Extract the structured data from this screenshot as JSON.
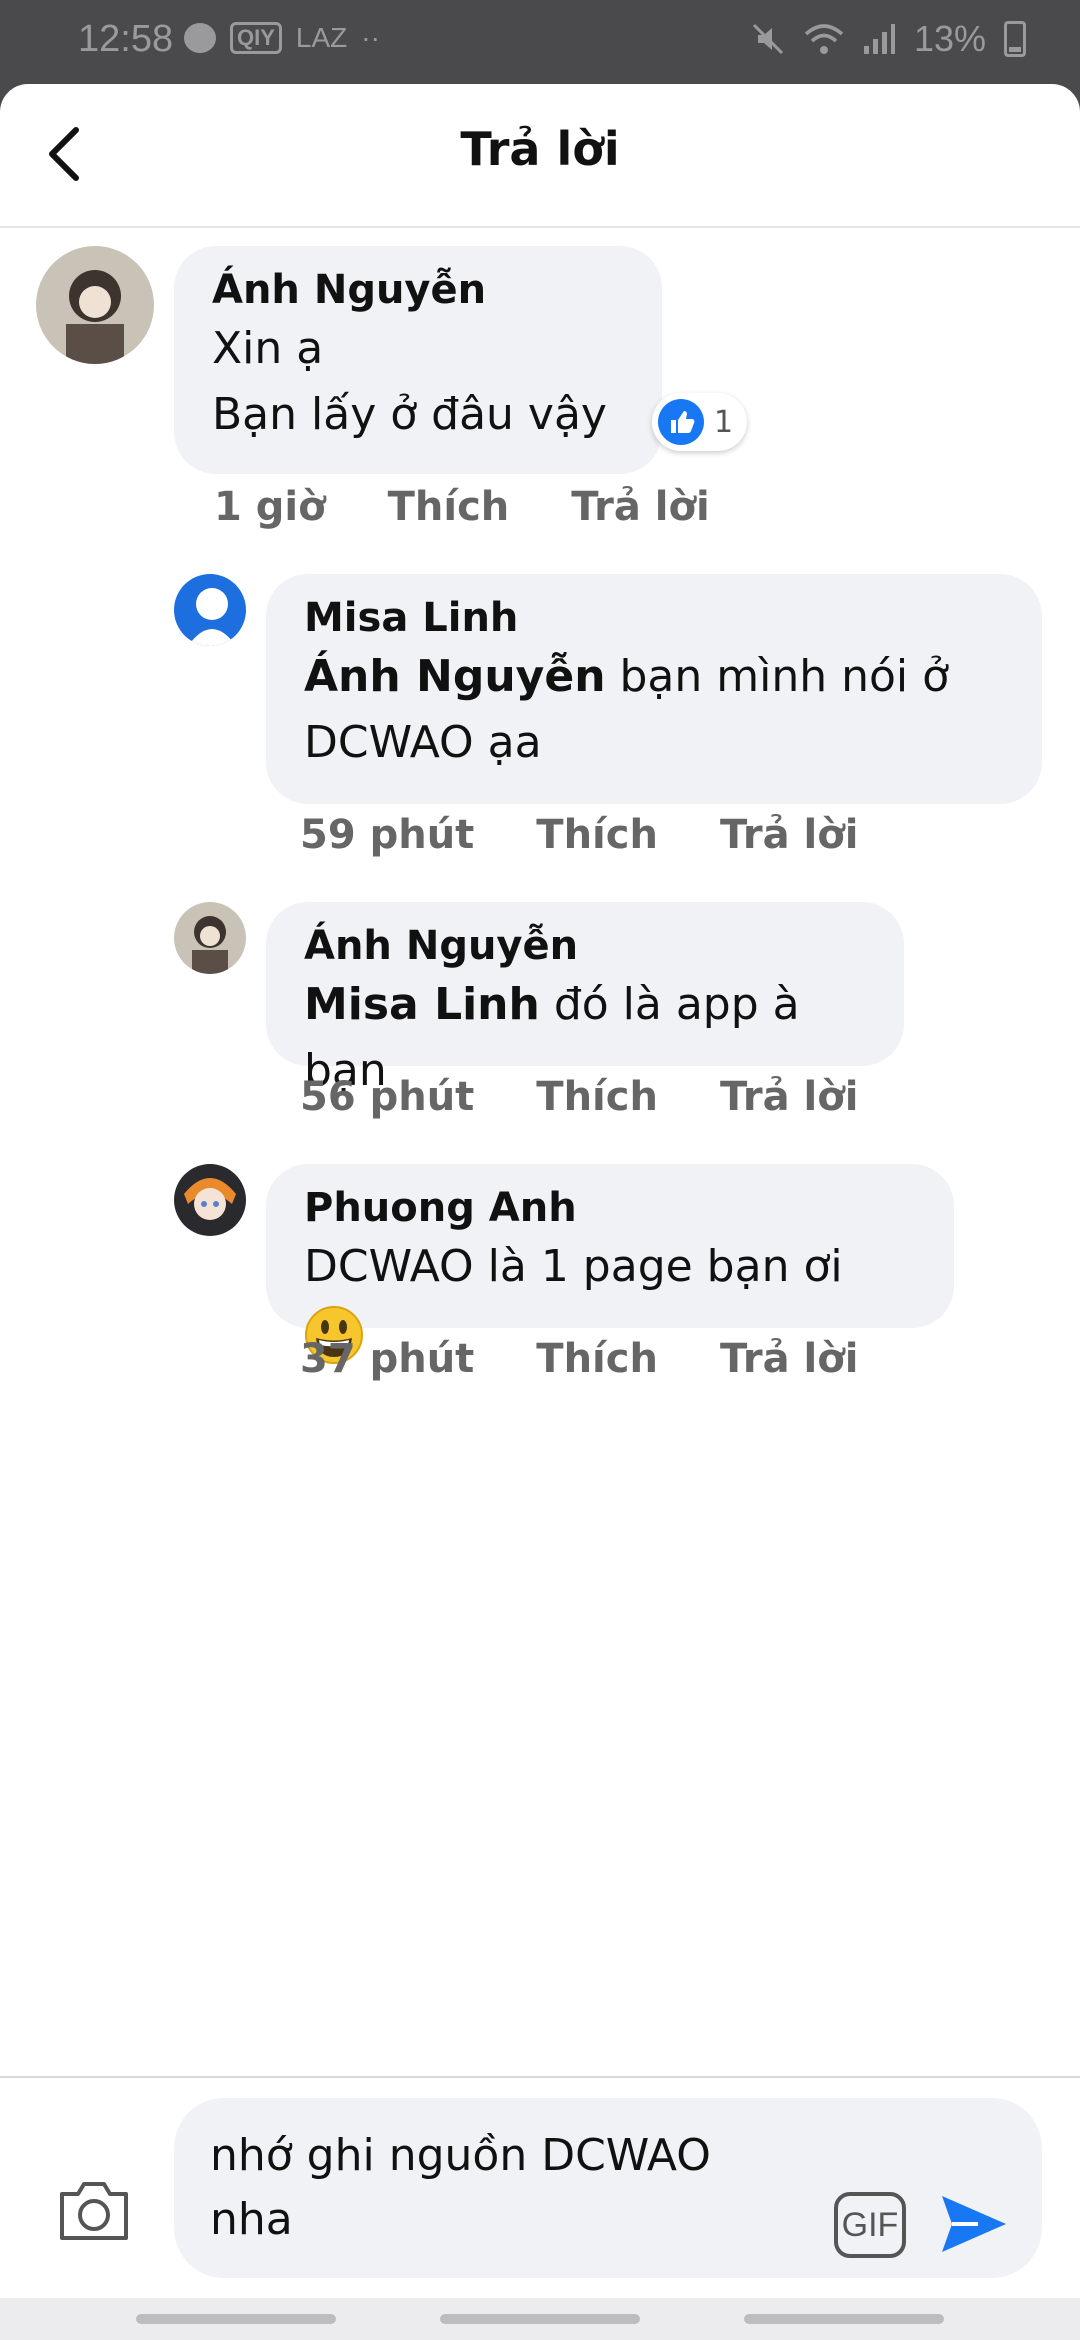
{
  "status_bar": {
    "time": "12:58",
    "notif_labels": [
      "QIY",
      "LAZ",
      "··"
    ],
    "battery": "13%"
  },
  "header": {
    "title": "Trả lời"
  },
  "comments": [
    {
      "author": "Ánh Nguyễn",
      "lines": [
        "Xin ạ",
        "Bạn lấy ở đâu vậy"
      ],
      "reaction_count": "1",
      "meta": {
        "time": "1 giờ",
        "like": "Thích",
        "reply": "Trả lời"
      }
    },
    {
      "author": "Misa Linh",
      "mention": "Ánh Nguyễn",
      "text_line1": " bạn mình nói ở",
      "text_line2": "DCWAO ạa",
      "meta": {
        "time": "59 phút",
        "like": "Thích",
        "reply": "Trả lời"
      }
    },
    {
      "author": "Ánh Nguyễn",
      "mention": "Misa Linh",
      "text": " đó là app à bạn",
      "meta": {
        "time": "56 phút",
        "like": "Thích",
        "reply": "Trả lời"
      }
    },
    {
      "author": "Phuong Anh",
      "text": "DCWAO là 1 page bạn ơi ",
      "emoji": "grinning-face",
      "meta": {
        "time": "37 phút",
        "like": "Thích",
        "reply": "Trả lời"
      }
    }
  ],
  "composer": {
    "value": "nhớ ghi nguồn DCWAO nha",
    "gif_label": "GIF"
  },
  "colors": {
    "accent": "#1877f2",
    "bubble": "#f0f2f5",
    "meta_text": "#666666"
  }
}
